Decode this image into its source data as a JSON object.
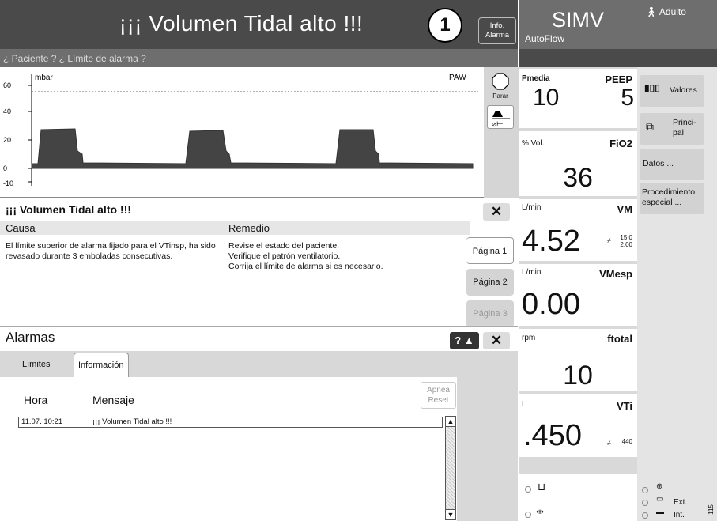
{
  "header": {
    "alarm_title": "¡¡¡ Volumen Tidal alto !!!",
    "callout_number": "1",
    "info_alarm": "Info.\nAlarma",
    "subheader": "¿ Paciente ? ¿ Límite de alarma ?",
    "mode": "SIMV",
    "mode_sub": "AutoFlow",
    "patient": "Adulto"
  },
  "graph": {
    "unit": "mbar",
    "label": "PAW",
    "y_ticks": [
      "60",
      "40",
      "20",
      "0",
      "-10"
    ],
    "stop_label": "Parar"
  },
  "message": {
    "title": "¡¡¡ Volumen Tidal alto !!!",
    "causa_header": "Causa",
    "remedio_header": "Remedio",
    "causa_text": "El límite superior de alarma fijado para el VTinsp, ha sido revasado durante 3 emboladas consecutivas.",
    "remedio_lines": [
      "Revise el estado del paciente.",
      "Verifique el patrón ventilatorio.",
      "Corrija el límite de alarma si es necesario."
    ],
    "pages": [
      "Página 1",
      "Página 2",
      "Página 3"
    ]
  },
  "alarms": {
    "title": "Alarmas",
    "help": "? ▲",
    "tabs": [
      "Límites",
      "Información"
    ],
    "col_hora": "Hora",
    "col_mensaje": "Mensaje",
    "apnea_reset": "Apnea\nReset",
    "rows": [
      {
        "hora": "11.07.  10:21",
        "mensaje": "¡¡¡ Volumen Tidal alto !!!"
      }
    ]
  },
  "params": [
    {
      "unit": "Pmedia",
      "name": "PEEP",
      "value_left": "10",
      "value_right": "5"
    },
    {
      "unit": "% Vol.",
      "name": "FiO2",
      "value": "36"
    },
    {
      "unit": "L/min",
      "name": "VM",
      "value": "4.52",
      "limit_hi": "15.0",
      "limit_lo": "2.00"
    },
    {
      "unit": "L/min",
      "name": "VMesp",
      "value": "0.00"
    },
    {
      "unit": "rpm",
      "name": "ftotal",
      "value": "10"
    },
    {
      "unit": "L",
      "name": "VTi",
      "value": ".450",
      "limit": ".440"
    }
  ],
  "side_buttons": [
    "Valores",
    "Princi-\npal",
    "Datos ...",
    "Procedimiento especial ..."
  ],
  "power": {
    "ext": "Ext.",
    "int": "Int."
  },
  "figure_id": "115"
}
